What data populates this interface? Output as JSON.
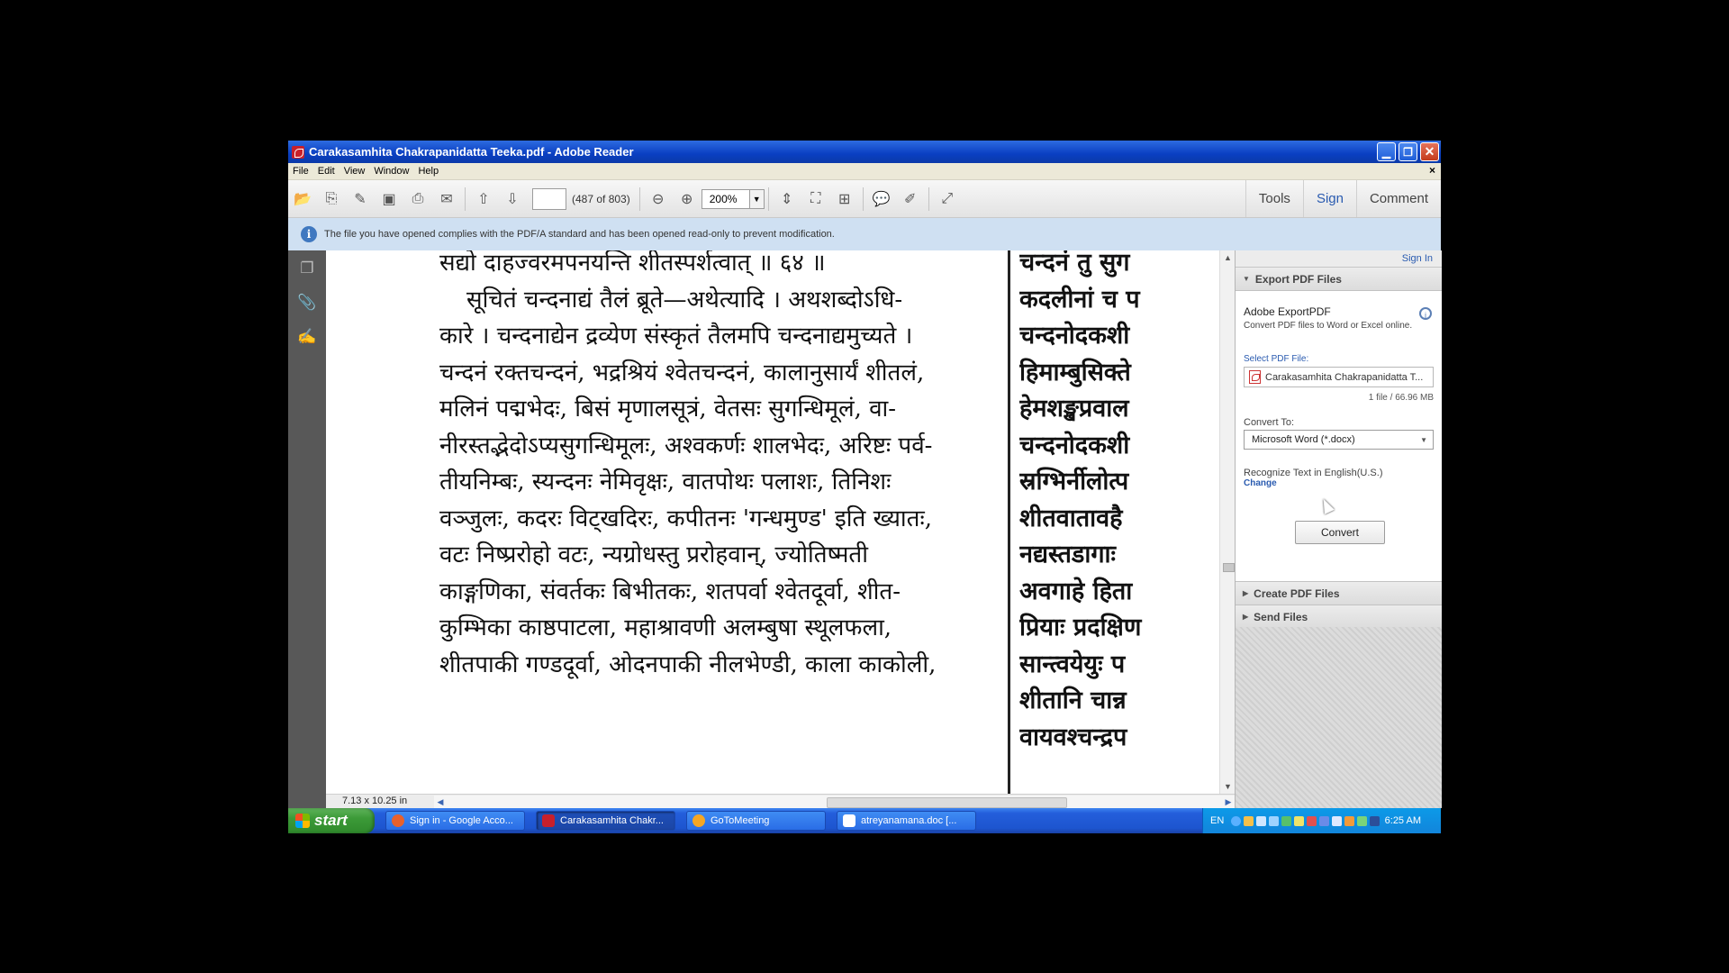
{
  "window": {
    "title": "Carakasamhita Chakrapanidatta Teeka.pdf - Adobe Reader"
  },
  "menu": [
    "File",
    "Edit",
    "View",
    "Window",
    "Help"
  ],
  "toolbar": {
    "page_count": "(487 of 803)",
    "zoom": "200%",
    "tools_label": "Tools",
    "sign_label": "Sign",
    "comment_label": "Comment"
  },
  "infobar": {
    "message": "The file you have opened complies with the PDF/A standard and has been opened read-only to prevent modification."
  },
  "document": {
    "col1_lines": [
      "सद्यो दाहज्वरमपनयन्ति शीतस्पर्शत्वात् ॥ ६४ ॥",
      "सूचितं चन्दनाद्यं तैलं ब्रूते—अथेत्यादि । अथशब्दोऽधि-",
      "कारे । चन्दनाद्येन द्रव्येण संस्कृतं तैलमपि चन्दनाद्यमुच्यते ।",
      "चन्दनं रक्तचन्दनं, भद्रश्रियं श्वेतचन्दनं, कालानुसार्यं शीतलं,",
      "मलिनं पद्मभेदः, बिसं मृणालसूत्रं, वेतसः सुगन्धिमूलं, वा-",
      "नीरस्तद्भेदोऽप्यसुगन्धिमूलः, अश्वकर्णः शालभेदः, अरिष्टः पर्व-",
      "तीयनिम्बः, स्यन्दनः नेमिवृक्षः, वातपोथः पलाशः, तिनिशः",
      "वञ्जुलः, कदरः विट्खदिरः, कपीतनः 'गन्धमुण्ड' इति ख्यातः,",
      "वटः निष्प्ररोहो वटः, न्यग्रोधस्तु प्ररोहवान्, ज्योतिष्मती",
      "काङ्गणिका, संवर्तकः बिभीतकः, शतपर्वा श्वेतदूर्वा, शीत-",
      "कुम्भिका काष्ठपाटला, महाश्रावणी अलम्बुषा स्थूलफला,",
      "शीतपाकी गण्डदूर्वा, ओदनपाकी नीलभेण्डी, काला काकोली,"
    ],
    "col2_lines": [
      "चन्दनं तु सुग",
      "कदलीनां च प",
      "चन्दनोदकशी",
      "हिमाम्बुसिक्ते",
      "हेमशङ्खप्रवाल",
      "चन्दनोदकशी",
      "स्रग्भिर्नीलोत्प",
      "शीतवातावहै",
      "नद्यस्तडागाः",
      "अवगाहे हिता",
      "प्रियाः प्रदक्षिण",
      "सान्त्वयेयुः प",
      "शीतानि चान्न",
      "वायवश्चन्द्रप"
    ]
  },
  "status": {
    "page_size": "7.13 x 10.25 in"
  },
  "panel": {
    "signin": "Sign In",
    "export_header": "Export PDF Files",
    "export_title": "Adobe ExportPDF",
    "export_sub": "Convert PDF files to Word or Excel online.",
    "select_label": "Select PDF File:",
    "file_name": "Carakasamhita Chakrapanidatta T...",
    "file_size": "1 file / 66.96 MB",
    "convert_to_label": "Convert To:",
    "convert_to_value": "Microsoft Word (*.docx)",
    "recognize_label": "Recognize Text in English(U.S.)",
    "change_link": "Change",
    "convert_button": "Convert",
    "create_header": "Create PDF Files",
    "send_header": "Send Files"
  },
  "taskbar": {
    "start": "start",
    "tasks": [
      {
        "label": "Sign in - Google Acco...",
        "color": "#e8612c"
      },
      {
        "label": "Carakasamhita Chakr...",
        "color": "#c8202b"
      },
      {
        "label": "GoToMeeting",
        "color": "#f5a623"
      },
      {
        "label": "atreyanamana.doc [...",
        "color": "#ffffff"
      }
    ],
    "lang": "EN",
    "clock": "6:25 AM"
  }
}
